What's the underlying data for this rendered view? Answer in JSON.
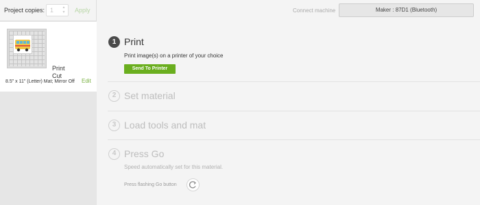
{
  "project": {
    "copies_label": "Project copies:",
    "copies_value": "1",
    "apply_label": "Apply"
  },
  "mat": {
    "lines": [
      "Print",
      "Cut"
    ],
    "info": "8.5\" x 11\" (Letter) Mat; Mirror Off",
    "edit_label": "Edit"
  },
  "machine": {
    "connect_label": "Connect machine",
    "selected": "Maker : 87D1 (Bluetooth)"
  },
  "steps": [
    {
      "number": "1",
      "title": "Print",
      "description": "Print image(s) on a printer of your choice",
      "button": "Send To Printer",
      "state": "active"
    },
    {
      "number": "2",
      "title": "Set material",
      "state": "inactive"
    },
    {
      "number": "3",
      "title": "Load tools and mat",
      "state": "inactive"
    },
    {
      "number": "4",
      "title": "Press Go",
      "description": "Speed automatically set for this material.",
      "go_label": "Press flashing Go button",
      "state": "inactive"
    }
  ],
  "icons": {
    "go": "go-button-icon",
    "art": "bus-image-icon"
  },
  "colors": {
    "accent_green": "#6aae1e",
    "edit_green": "#79b141",
    "active_badge": "#4a4a4a"
  }
}
